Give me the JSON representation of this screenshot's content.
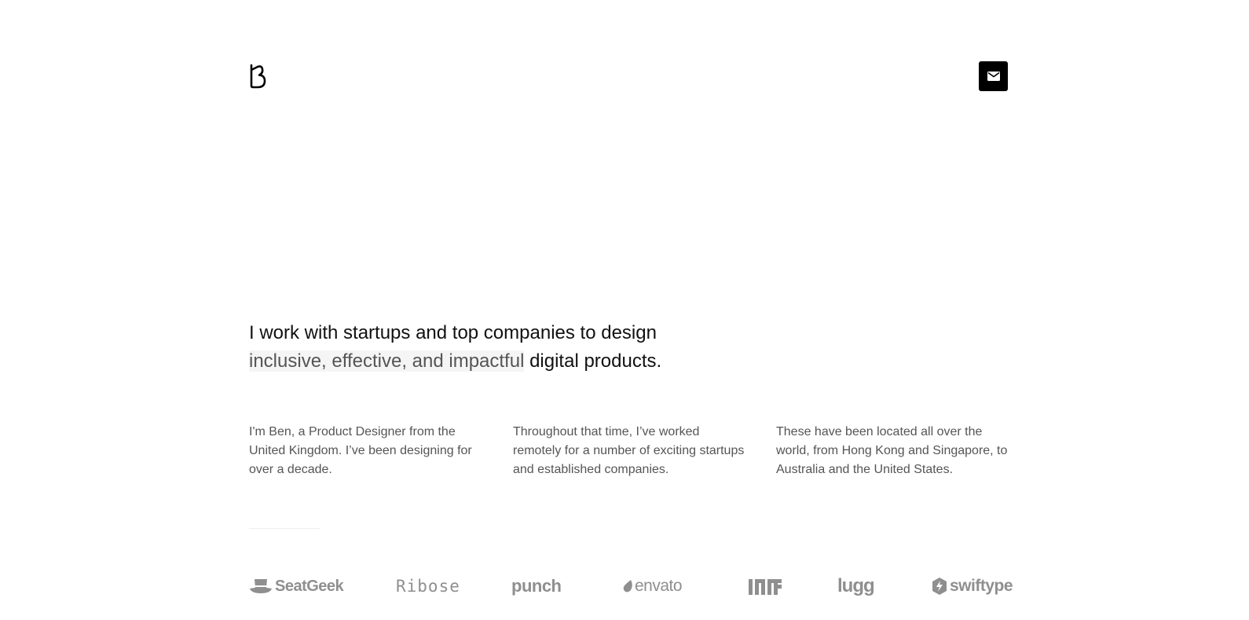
{
  "header": {
    "logo_icon": "b-monogram-logo-icon",
    "contact_icon": "mail-icon",
    "contact_button_color": "#000000"
  },
  "hero": {
    "headline_part1": "I work with startups and top companies to design",
    "headline_highlight": "inclusive, effective, and impactful",
    "headline_part2": " digital products."
  },
  "bio": {
    "col1": "I'm Ben, a Product Designer from the United Kingdom. I’ve been designing for over a decade.",
    "col2": "Throughout that time, I’ve worked remotely for a number of exciting startups and established companies.",
    "col3": "These have been located all over the world, from Hong Kong and Singapore, to Australia and the United States."
  },
  "clients": [
    {
      "name": "SeatGeek",
      "icon": "top-hat-icon"
    },
    {
      "name": "Ribose"
    },
    {
      "name": "punch"
    },
    {
      "name": "envato",
      "icon": "leaf-icon"
    },
    {
      "name": "MIT",
      "icon": "mit-logo-icon"
    },
    {
      "name": "lugg"
    },
    {
      "name": "swiftype",
      "icon": "bolt-icon"
    }
  ],
  "colors": {
    "text_primary": "#111111",
    "text_secondary": "#555555",
    "logo_gray": "#8f8f8f",
    "highlight_bg": "#f5f5f5"
  }
}
